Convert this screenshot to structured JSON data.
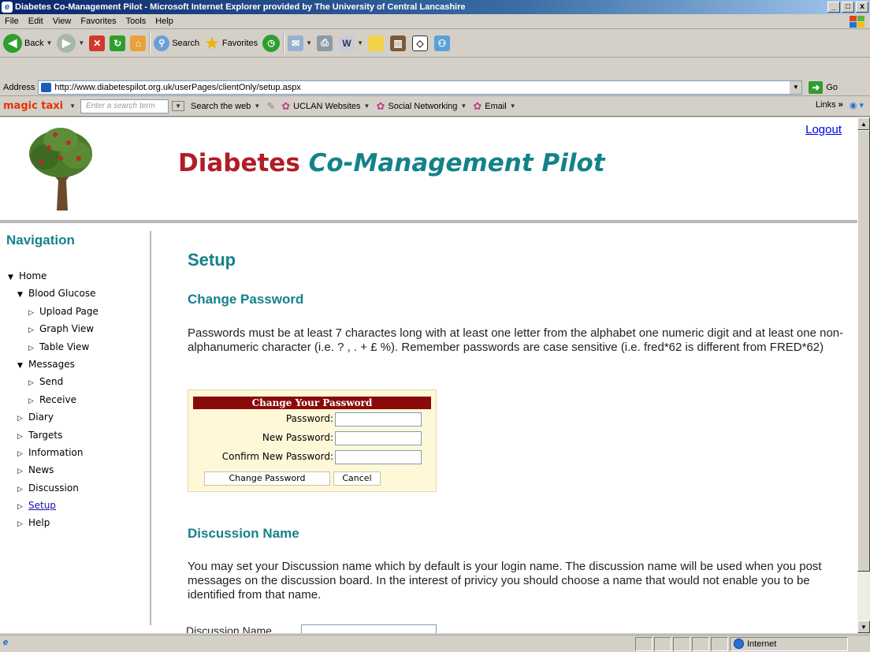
{
  "window": {
    "title": "Diabetes Co-Management Pilot - Microsoft Internet Explorer provided by The University of Central Lancashire",
    "controls": [
      "_",
      "□",
      "x"
    ]
  },
  "menu": [
    "File",
    "Edit",
    "View",
    "Favorites",
    "Tools",
    "Help"
  ],
  "toolbar": {
    "back_label": "Back",
    "search_label": "Search",
    "favorites_label": "Favorites"
  },
  "address": {
    "label": "Address",
    "url": "http://www.diabetespilot.org.uk/userPages/clientOnly/setup.aspx",
    "go_label": "Go"
  },
  "linksbar": {
    "brand": "magic taxi",
    "search_placeholder": "Enter a search term",
    "search_web": "Search the web",
    "uclan": "UCLAN Websites",
    "social": "Social Networking",
    "email": "Email",
    "links": "Links",
    "chevron": "»"
  },
  "page": {
    "logout": "Logout",
    "title_part1": "Diabetes",
    "title_part2": "Co-Management Pilot",
    "nav_heading": "Navigation",
    "nav": [
      {
        "label": "Home",
        "level": 1,
        "expanded": true
      },
      {
        "label": "Blood Glucose",
        "level": 2,
        "expanded": true
      },
      {
        "label": "Upload Page",
        "level": 3,
        "expanded": false
      },
      {
        "label": "Graph View",
        "level": 3,
        "expanded": false
      },
      {
        "label": "Table View",
        "level": 3,
        "expanded": false
      },
      {
        "label": "Messages",
        "level": 2,
        "expanded": true
      },
      {
        "label": "Send",
        "level": 3,
        "expanded": false
      },
      {
        "label": "Receive",
        "level": 3,
        "expanded": false
      },
      {
        "label": "Diary",
        "level": 2,
        "expanded": false
      },
      {
        "label": "Targets",
        "level": 2,
        "expanded": false
      },
      {
        "label": "Information",
        "level": 2,
        "expanded": false
      },
      {
        "label": "News",
        "level": 2,
        "expanded": false
      },
      {
        "label": "Discussion",
        "level": 2,
        "expanded": false
      },
      {
        "label": "Setup",
        "level": 2,
        "expanded": false,
        "current": true
      },
      {
        "label": "Help",
        "level": 2,
        "expanded": false
      }
    ],
    "heading": "Setup",
    "change_password_heading": "Change Password",
    "password_rules": "Passwords must be at least 7 charactes long with at least one letter from the alphabet one numeric digit and at least one non-alphanumeric character (i.e. ? , . + £ %). Remember passwords are case sensitive (i.e. fred*62 is different from FRED*62)",
    "form": {
      "header": "Change Your Password",
      "password_label": "Password:",
      "new_password_label": "New Password:",
      "confirm_label": "Confirm New Password:",
      "submit_label": "Change Password",
      "cancel_label": "Cancel"
    },
    "discussion_heading": "Discussion Name",
    "discussion_text": "You may set your Discussion name which by default is your login name. The discussion name will be used when you post messages on the discussion board. In the interest of privicy you should choose a name that would not enable you to be identified from that name.",
    "discussion_label": "Discussion Name"
  },
  "status": {
    "zone": "Internet"
  },
  "colors": {
    "accent_teal": "#13828a",
    "brand_red": "#b01c28",
    "form_header": "#8a0a0a"
  }
}
